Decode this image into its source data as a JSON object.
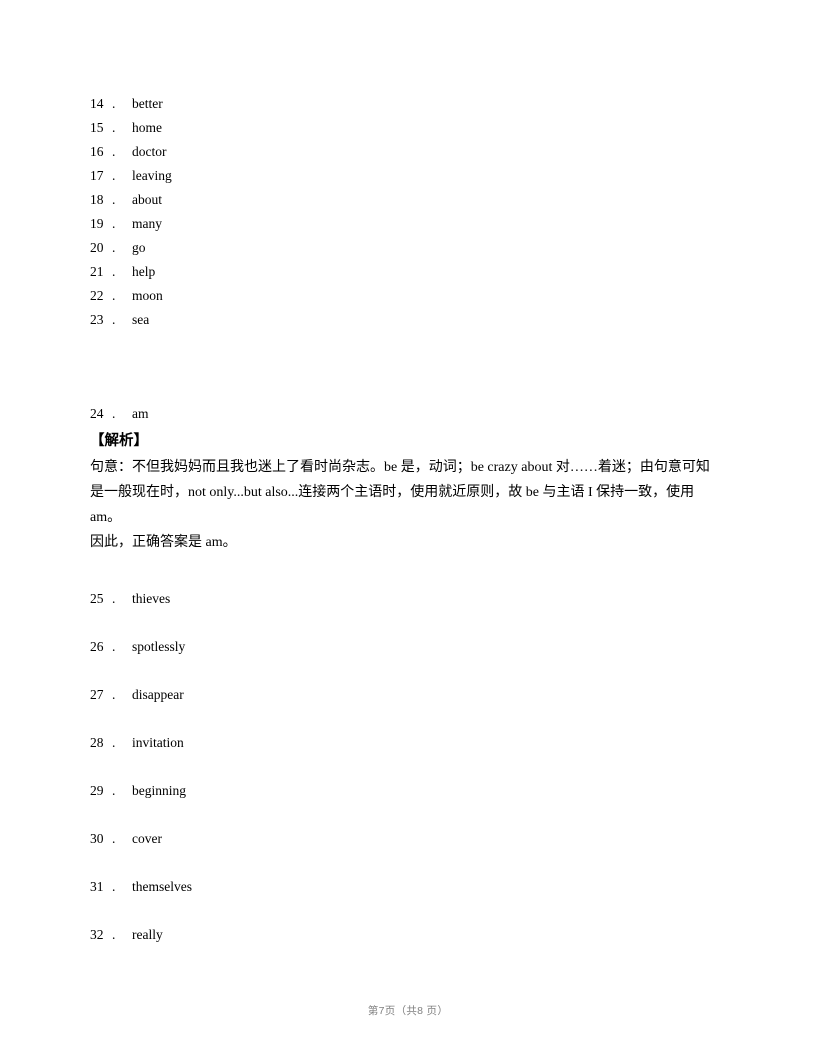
{
  "document": {
    "type": "answer-key-worksheet",
    "background_color": "#ffffff",
    "text_color": "#000000"
  },
  "answers_top": [
    {
      "number": "14",
      "separator": ".",
      "word": "better"
    },
    {
      "number": "15",
      "separator": ".",
      "word": "home"
    },
    {
      "number": "16",
      "separator": ".",
      "word": "doctor"
    },
    {
      "number": "17",
      "separator": ".",
      "word": "leaving"
    },
    {
      "number": "18",
      "separator": ".",
      "word": "about"
    },
    {
      "number": "19",
      "separator": ".",
      "word": "many"
    },
    {
      "number": "20",
      "separator": ".",
      "word": "go"
    },
    {
      "number": "21",
      "separator": ".",
      "word": "help"
    },
    {
      "number": "22",
      "separator": ".",
      "word": "moon"
    },
    {
      "number": "23",
      "separator": ".",
      "word": "sea"
    }
  ],
  "solution": {
    "number": "24",
    "separator": ".",
    "word": "am",
    "label": "【解析】",
    "lines": [
      "句意：不但我妈妈而且我也迷上了看时尚杂志。be 是，动词；be crazy about 对……着迷；由句意可知",
      "是一般现在时，not only...but also...连接两个主语时，使用就近原则，故 be 与主语 I 保持一致，使用",
      "am。",
      "因此，正确答案是 am。"
    ]
  },
  "answers_bottom": [
    {
      "number": "25",
      "separator": ".",
      "word": "thieves"
    },
    {
      "number": "26",
      "separator": ".",
      "word": "spotlessly"
    },
    {
      "number": "27",
      "separator": ".",
      "word": "disappear"
    },
    {
      "number": "28",
      "separator": ".",
      "word": "invitation"
    },
    {
      "number": "29",
      "separator": ".",
      "word": "beginning"
    },
    {
      "number": "30",
      "separator": ".",
      "word": "cover"
    },
    {
      "number": "31",
      "separator": ".",
      "word": "themselves"
    },
    {
      "number": "32",
      "separator": ".",
      "word": "really"
    }
  ],
  "footer": {
    "text": "第7页（共8 页）",
    "current_page": "7",
    "total_pages": "8",
    "color": "#808080"
  }
}
